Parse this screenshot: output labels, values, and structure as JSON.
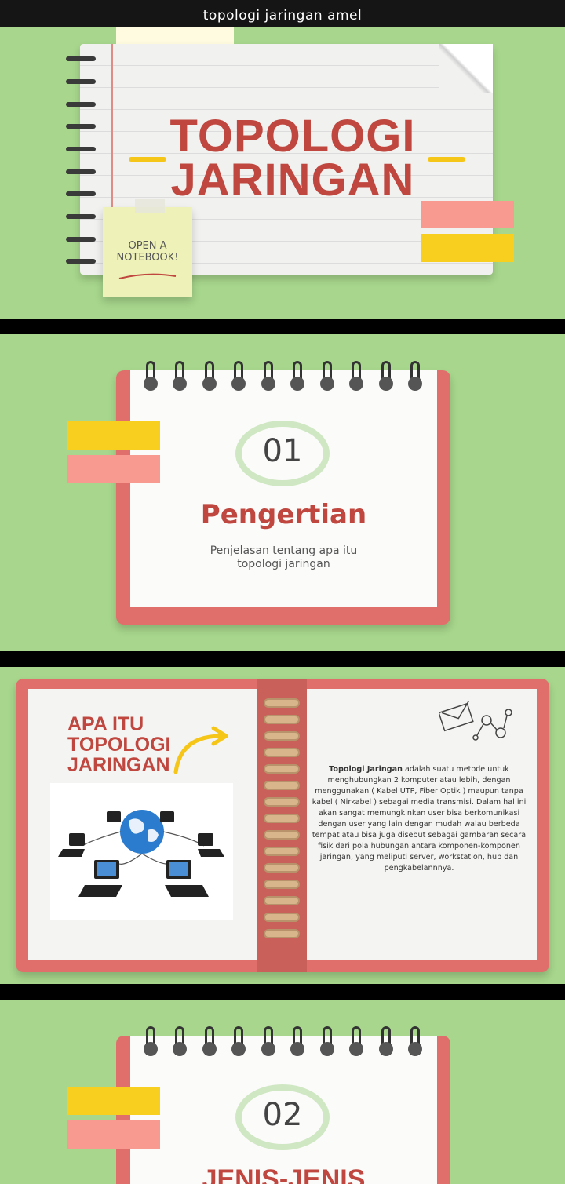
{
  "topbar": {
    "title": "topologi jaringan amel"
  },
  "slide1": {
    "title_line1": "TOPOLOGI",
    "title_line2": "JARINGAN",
    "sticky_line1": "OPEN A",
    "sticky_line2": "NOTEBOOK!"
  },
  "slide2": {
    "number": "01",
    "heading": "Pengertian",
    "sub_line1": "Penjelasan tentang apa itu",
    "sub_line2": "topologi jaringan"
  },
  "slide3": {
    "heading_line1": "APA ITU",
    "heading_line2": "TOPOLOGI",
    "heading_line3": "JARINGAN",
    "desc_bold": "Topologi Jaringan",
    "desc_rest": " adalah suatu metode untuk menghubungkan 2 komputer atau lebih, dengan menggunakan ( Kabel UTP, Fiber Optik ) maupun tanpa kabel ( Nirkabel ) sebagai media transmisi. Dalam hal ini akan sangat memungkinkan user bisa berkomunikasi dengan user yang lain dengan mudah walau berbeda tempat atau bisa juga disebut sebagai gambaran secara fisik dari pola hubungan antara komponen-komponen jaringan, yang meliputi server, workstation, hub dan pengkabelannnya.",
    "image_icon": "network-globe-laptops-image"
  },
  "slide4": {
    "number": "02",
    "heading_partial": "JENIS-JENIS"
  },
  "colors": {
    "background_green": "#a7d68c",
    "accent_red": "#c0473f",
    "notebook_red": "#e06f6b",
    "tab_yellow": "#f9cf1f",
    "tab_pink": "#f99a90"
  }
}
